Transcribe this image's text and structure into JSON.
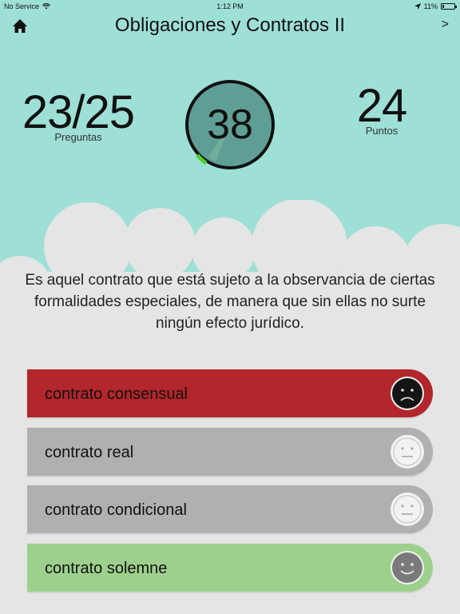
{
  "status_bar": {
    "carrier": "No Service",
    "time": "1:12 PM",
    "battery": "11%",
    "battery_level": 0.11
  },
  "header": {
    "title": "Obligaciones y Contratos II",
    "next_label": ">"
  },
  "stats": {
    "questions_value": "23/25",
    "questions_label": "Preguntas",
    "timer_value": "38",
    "points_value": "24",
    "points_label": "Puntos"
  },
  "question": {
    "text": "Es aquel contrato que está sujeto a la observancia de ciertas formalidades especiales, de manera que sin ellas no surte ningún efecto jurídico."
  },
  "answers": [
    {
      "label": "contrato consensual",
      "state": "wrong",
      "face": "sad-face-icon"
    },
    {
      "label": "contrato real",
      "state": "neutral",
      "face": "neutral-face-icon"
    },
    {
      "label": "contrato condicional",
      "state": "neutral",
      "face": "neutral-face-icon"
    },
    {
      "label": "contrato solemne",
      "state": "correct",
      "face": "happy-face-icon"
    }
  ],
  "colors": {
    "background": "#9edfd6",
    "cloud": "#e5e5e5",
    "wrong": "#b3262b",
    "neutral": "#b0b0b0",
    "correct": "#9dd08d",
    "timer_fill": "#5f9e95",
    "timer_progress": "#4ed12c"
  }
}
